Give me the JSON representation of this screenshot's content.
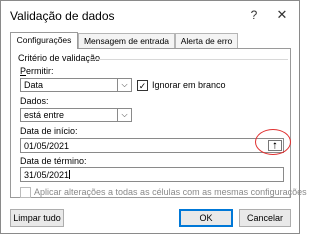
{
  "window": {
    "title": "Validação de dados",
    "help_glyph": "?",
    "close_glyph": "✕"
  },
  "tabs": [
    {
      "label": "Configurações"
    },
    {
      "label": "Mensagem de entrada"
    },
    {
      "label": "Alerta de erro"
    }
  ],
  "criteria": {
    "group_label": "Critério de validação",
    "allow_label": "Permitir:",
    "allow_value": "Data",
    "ignore_blank_label": "Ignorar em branco",
    "ignore_blank_checked": true,
    "data_label": "Dados:",
    "data_value": "está entre",
    "start_label": "Data de início:",
    "start_value": "01/05/2021",
    "end_label": "Data de término:",
    "end_value": "31/05/2021",
    "apply_all_label": "Aplicar alterações a todas as células com as mesmas configurações",
    "apply_all_checked": false
  },
  "icons": {
    "dropdown": "chevron-down-icon",
    "range_selector": "collapse-dialog-icon"
  },
  "buttons": {
    "clear_all": "Limpar tudo",
    "ok": "OK",
    "cancel": "Cancelar"
  },
  "colors": {
    "accent": "#0078d7",
    "highlight": "#e03030"
  }
}
